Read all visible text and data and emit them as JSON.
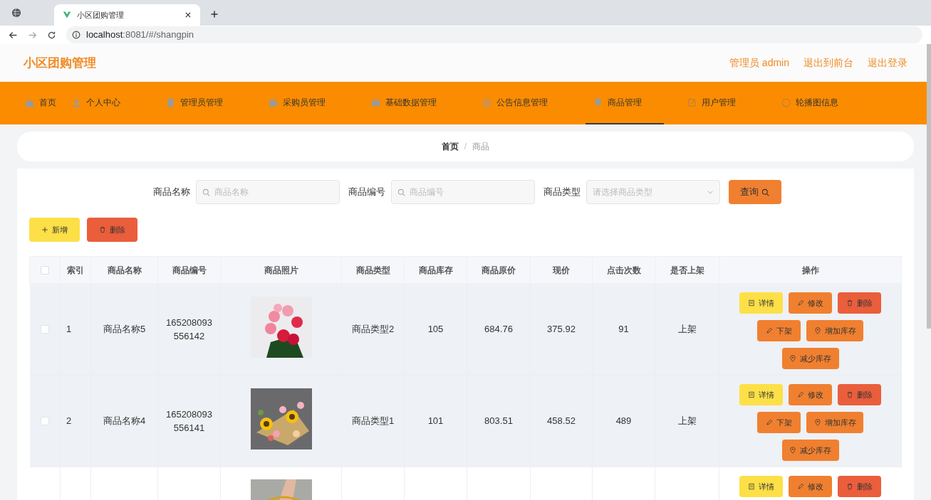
{
  "browser": {
    "tab_title": "小区团购管理",
    "url_host": "localhost",
    "url_rest": ":8081/#/shangpin"
  },
  "header": {
    "title": "小区团购管理",
    "links": [
      "管理员 admin",
      "退出到前台",
      "退出登录"
    ]
  },
  "nav": [
    {
      "label": "首页",
      "selected": false
    },
    {
      "label": "个人中心",
      "selected": false
    },
    {
      "label": "管理员管理",
      "selected": false
    },
    {
      "label": "采购员管理",
      "selected": false
    },
    {
      "label": "基础数据管理",
      "selected": false
    },
    {
      "label": "公告信息管理",
      "selected": false
    },
    {
      "label": "商品管理",
      "selected": true
    },
    {
      "label": "用户管理",
      "selected": false
    },
    {
      "label": "轮播图信息",
      "selected": false
    }
  ],
  "breadcrumb": {
    "items": [
      "首页",
      "商品"
    ],
    "separator": "/"
  },
  "search": {
    "fields": [
      {
        "kind": "input",
        "label": "商品名称",
        "placeholder": "商品名称"
      },
      {
        "kind": "input",
        "label": "商品编号",
        "placeholder": "商品编号"
      },
      {
        "kind": "select",
        "label": "商品类型",
        "placeholder": "请选择商品类型"
      }
    ],
    "button": "查询"
  },
  "toolbar": [
    {
      "kind": "add",
      "label": "新增"
    },
    {
      "kind": "delete",
      "label": "删除"
    }
  ],
  "table": {
    "all_checked": false,
    "columns": [
      "索引",
      "商品名称",
      "商品编号",
      "商品照片",
      "商品类型",
      "商品库存",
      "商品原价",
      "现价",
      "点击次数",
      "是否上架",
      "操作"
    ],
    "rows": [
      {
        "highlighted": true,
        "checked": false,
        "cells": [
          "1",
          "商品名称5",
          "165208093\n556142",
          "",
          "商品类型2",
          "105",
          "684.76",
          "375.92",
          "91",
          "上架"
        ],
        "actions": [
          {
            "kind": "detail",
            "label": "详情"
          },
          {
            "kind": "edit",
            "label": "修改"
          },
          {
            "kind": "delete",
            "label": "删除"
          },
          {
            "kind": "edit",
            "label": "下架"
          },
          {
            "kind": "pin",
            "label": "增加库存"
          },
          {
            "kind": "pin",
            "label": "减少库存"
          }
        ]
      },
      {
        "highlighted": true,
        "checked": false,
        "cells": [
          "2",
          "商品名称4",
          "165208093\n556141",
          "",
          "商品类型1",
          "101",
          "803.51",
          "458.52",
          "489",
          "上架"
        ],
        "actions": [
          {
            "kind": "detail",
            "label": "详情"
          },
          {
            "kind": "edit",
            "label": "修改"
          },
          {
            "kind": "delete",
            "label": "删除"
          },
          {
            "kind": "edit",
            "label": "下架"
          },
          {
            "kind": "pin",
            "label": "增加库存"
          },
          {
            "kind": "pin",
            "label": "减少库存"
          }
        ]
      },
      {
        "highlighted": false,
        "cells": [],
        "actions": [
          {
            "kind": "detail",
            "label": "详情"
          },
          {
            "kind": "edit",
            "label": "修改"
          },
          {
            "kind": "delete",
            "label": "删除"
          }
        ]
      }
    ]
  }
}
